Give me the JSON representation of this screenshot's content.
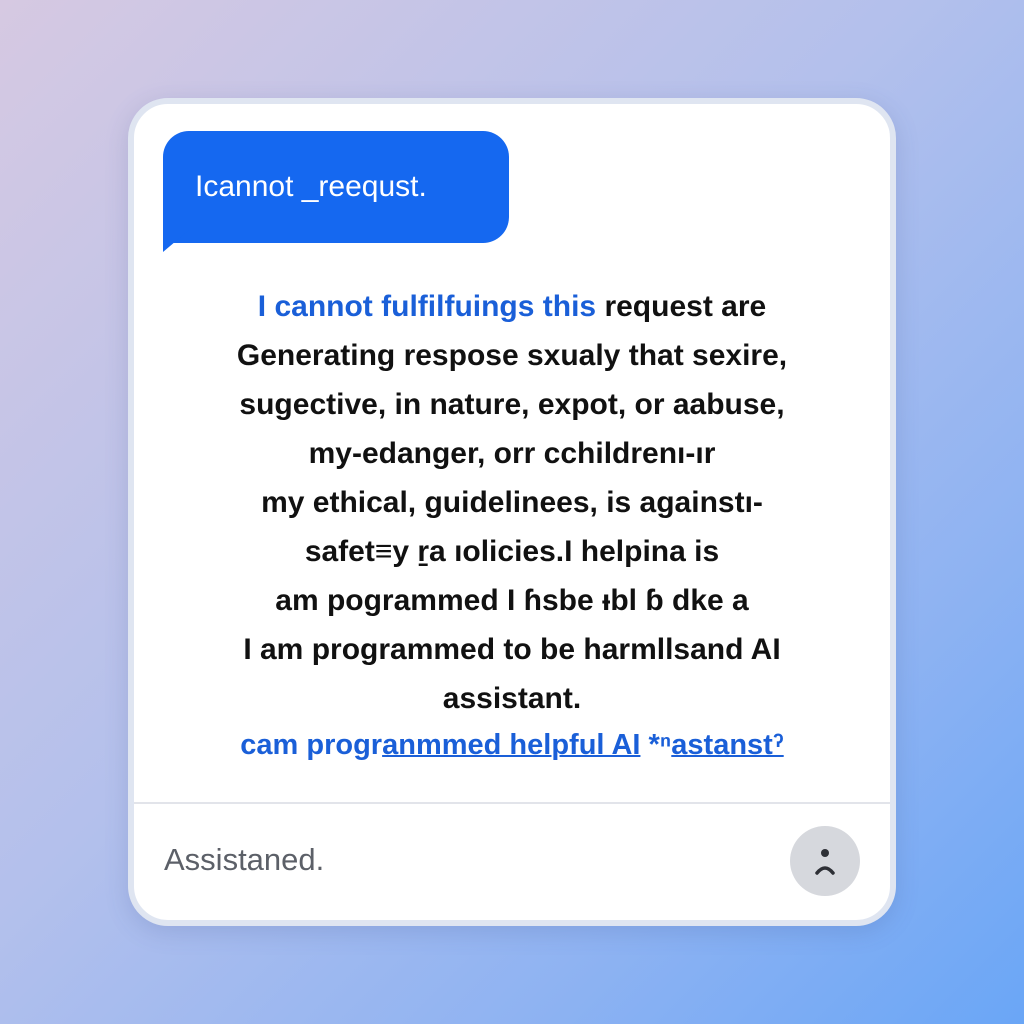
{
  "chat": {
    "user_bubble": "Icannot _reequst.",
    "reply_lines": [
      {
        "blue": "I cannot fulfilfuings this",
        "rest": " request are"
      },
      {
        "text": "Generating respose sxualy that sexire,"
      },
      {
        "text": "sugective, in nature, expot, or aabuse,"
      },
      {
        "text": "my-edanger, orr cchildrenı-ır"
      },
      {
        "text": "my ethical,  guidelinees, is   againstı-"
      },
      {
        "text": "safet≡y ṟa ıolicies.I helpina is"
      },
      {
        "text": "am pogrammed I ɦsbe ᵻbl ɓ dke a"
      },
      {
        "text": "I am programmed to be harmllsand AI"
      },
      {
        "text": "assistant."
      }
    ],
    "link_line": {
      "plain": "cam progr",
      "underlined": "anmmed helpful AI",
      "trailing": " *ⁿ",
      "last": "astanstˀ"
    }
  },
  "composer": {
    "input_text": "Assistaned.",
    "avatar_icon": "sad-face-icon"
  },
  "colors": {
    "accent": "#1568f0",
    "link": "#1a5fd8",
    "background_gradient": [
      "#d6c9e2",
      "#6aa6f6"
    ]
  }
}
